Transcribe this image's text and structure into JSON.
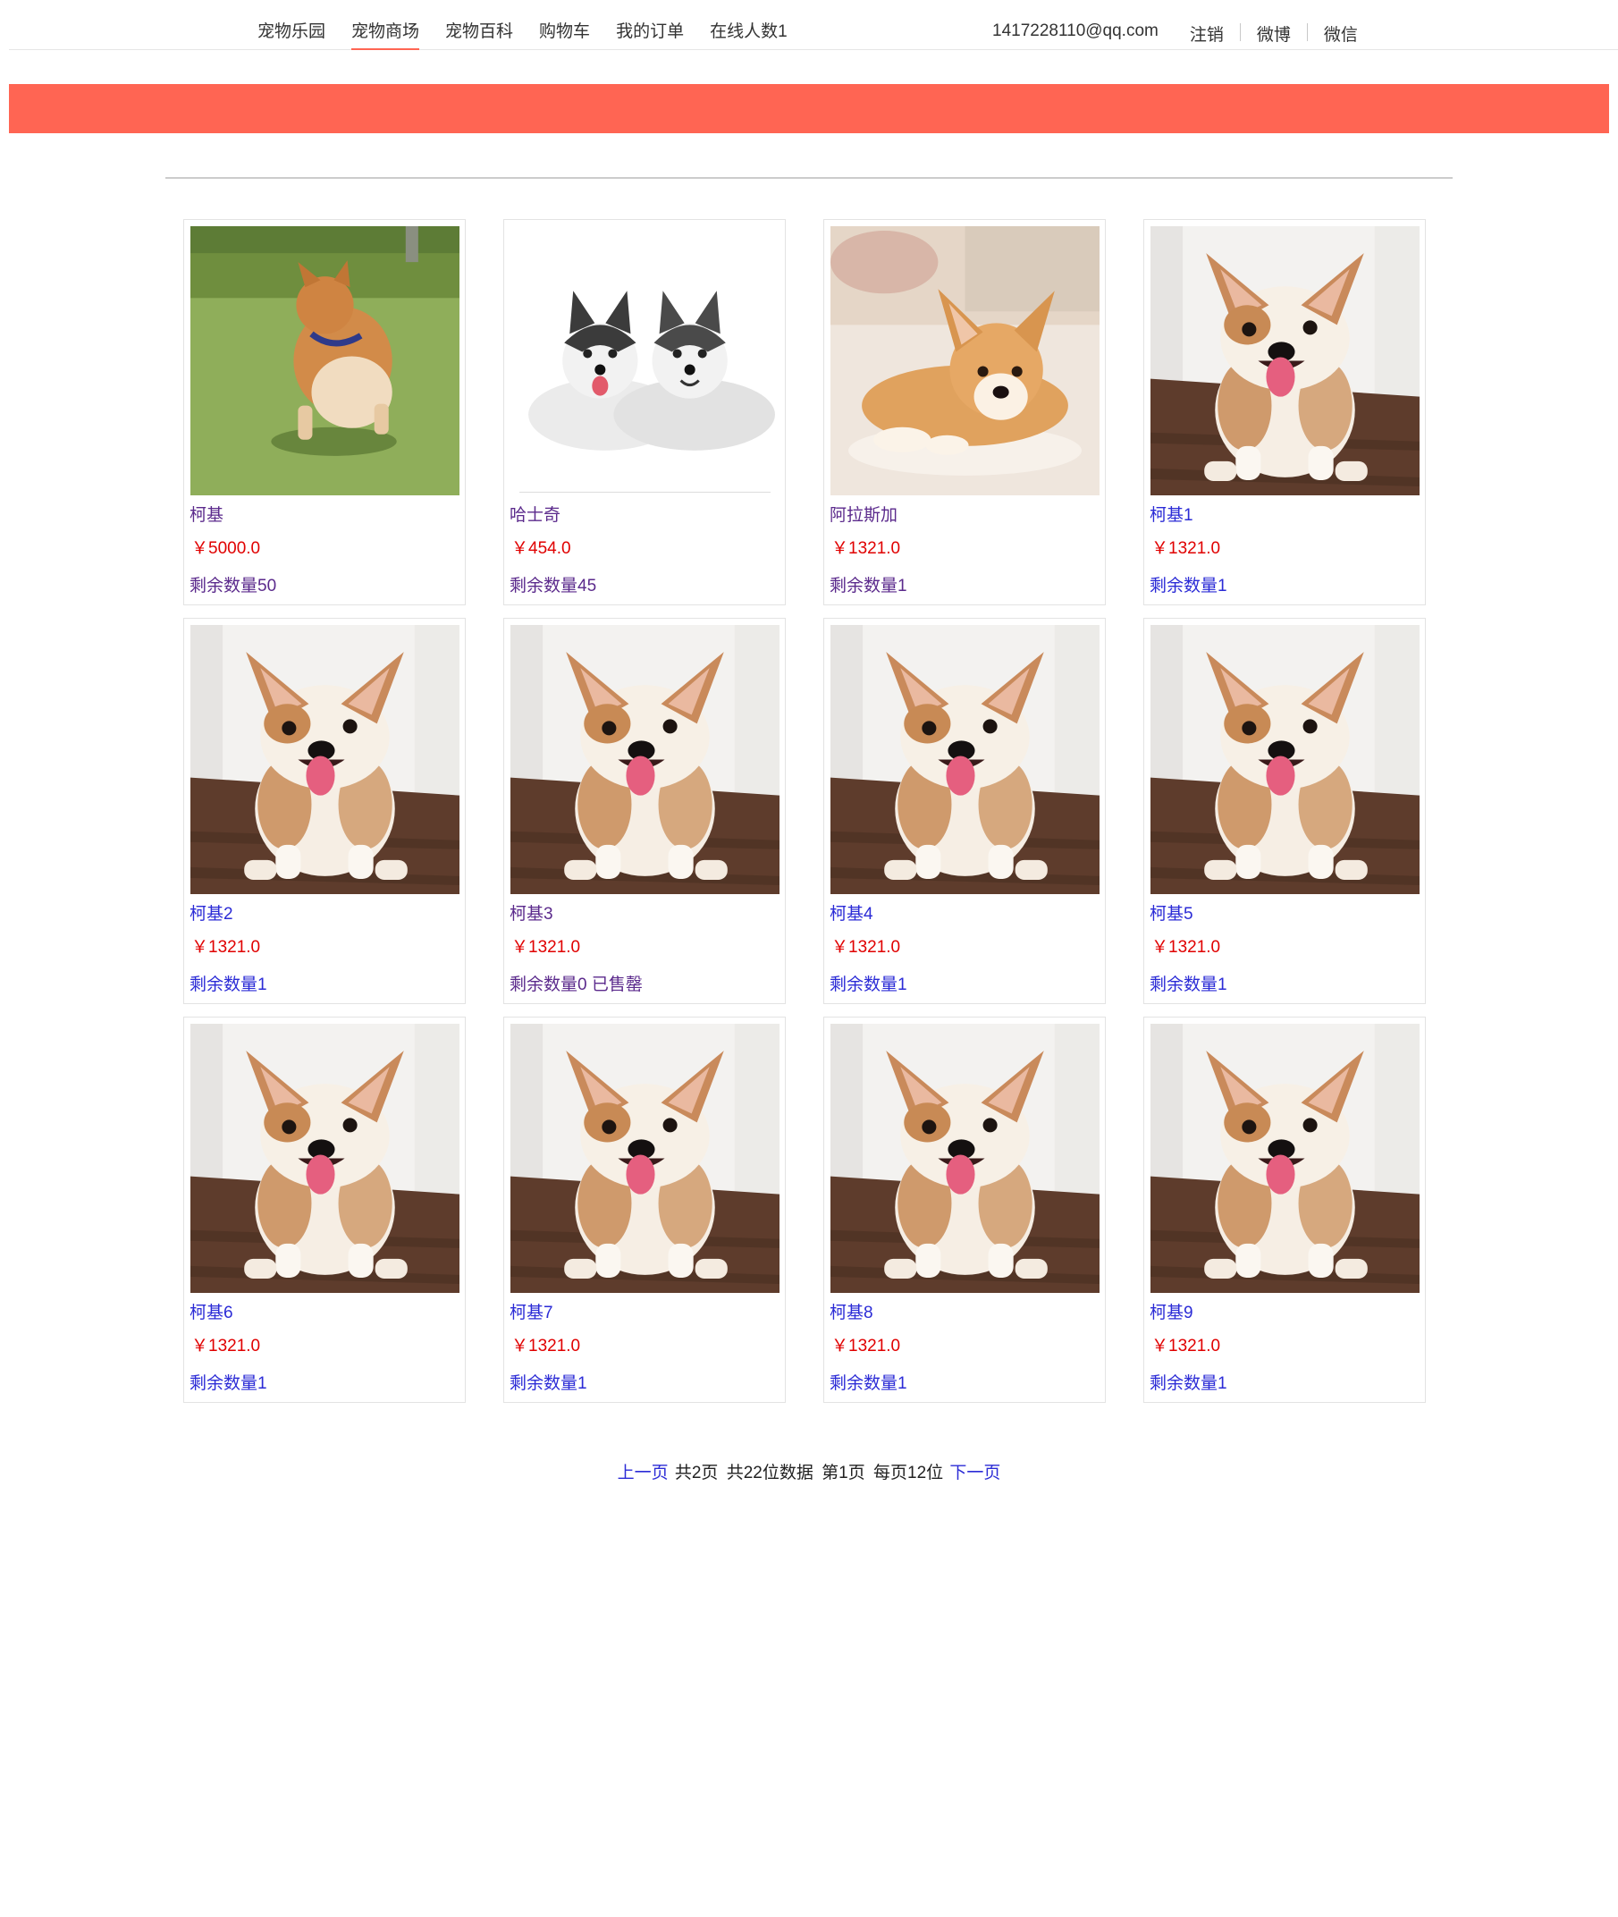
{
  "nav": {
    "items": [
      {
        "label": "宠物乐园",
        "active": false
      },
      {
        "label": "宠物商场",
        "active": true
      },
      {
        "label": "宠物百科",
        "active": false
      },
      {
        "label": "购物车",
        "active": false
      },
      {
        "label": "我的订单",
        "active": false
      },
      {
        "label": "在线人数1",
        "active": false
      }
    ],
    "user_email": "1417228110@qq.com",
    "logout_label": "注销",
    "weibo_label": "微博",
    "weixin_label": "微信"
  },
  "colors": {
    "accent": "#ff6553",
    "link": "#2b2bd6",
    "visited_link": "#5b2a8c",
    "price": "#e00000"
  },
  "products": [
    {
      "name": "柯基",
      "price": "￥5000.0",
      "stock": "剩余数量50",
      "image": "corgi-running-photo",
      "visited": true
    },
    {
      "name": "哈士奇",
      "price": "￥454.0",
      "stock": "剩余数量45",
      "image": "huskies-photo",
      "visited": true
    },
    {
      "name": "阿拉斯加",
      "price": "￥1321.0",
      "stock": "剩余数量1",
      "image": "corgi-puppy-lying-photo",
      "visited": true
    },
    {
      "name": "柯基1",
      "price": "￥1321.0",
      "stock": "剩余数量1",
      "image": "corgi-puppy-sitting-photo",
      "visited": false
    },
    {
      "name": "柯基2",
      "price": "￥1321.0",
      "stock": "剩余数量1",
      "image": "corgi-puppy-sitting-photo",
      "visited": false
    },
    {
      "name": "柯基3",
      "price": "￥1321.0",
      "stock": "剩余数量0 已售罄",
      "image": "corgi-puppy-sitting-photo",
      "visited": true
    },
    {
      "name": "柯基4",
      "price": "￥1321.0",
      "stock": "剩余数量1",
      "image": "corgi-puppy-sitting-photo",
      "visited": false
    },
    {
      "name": "柯基5",
      "price": "￥1321.0",
      "stock": "剩余数量1",
      "image": "corgi-puppy-sitting-photo",
      "visited": false
    },
    {
      "name": "柯基6",
      "price": "￥1321.0",
      "stock": "剩余数量1",
      "image": "corgi-puppy-sitting-photo",
      "visited": false
    },
    {
      "name": "柯基7",
      "price": "￥1321.0",
      "stock": "剩余数量1",
      "image": "corgi-puppy-sitting-photo",
      "visited": false
    },
    {
      "name": "柯基8",
      "price": "￥1321.0",
      "stock": "剩余数量1",
      "image": "corgi-puppy-sitting-photo",
      "visited": false
    },
    {
      "name": "柯基9",
      "price": "￥1321.0",
      "stock": "剩余数量1",
      "image": "corgi-puppy-sitting-photo",
      "visited": false
    }
  ],
  "pagination": {
    "prev_label": "上一页",
    "total_pages": "共2页",
    "total_records": "共22位数据",
    "current_page": "第1页",
    "per_page": "每页12位",
    "next_label": "下一页"
  }
}
